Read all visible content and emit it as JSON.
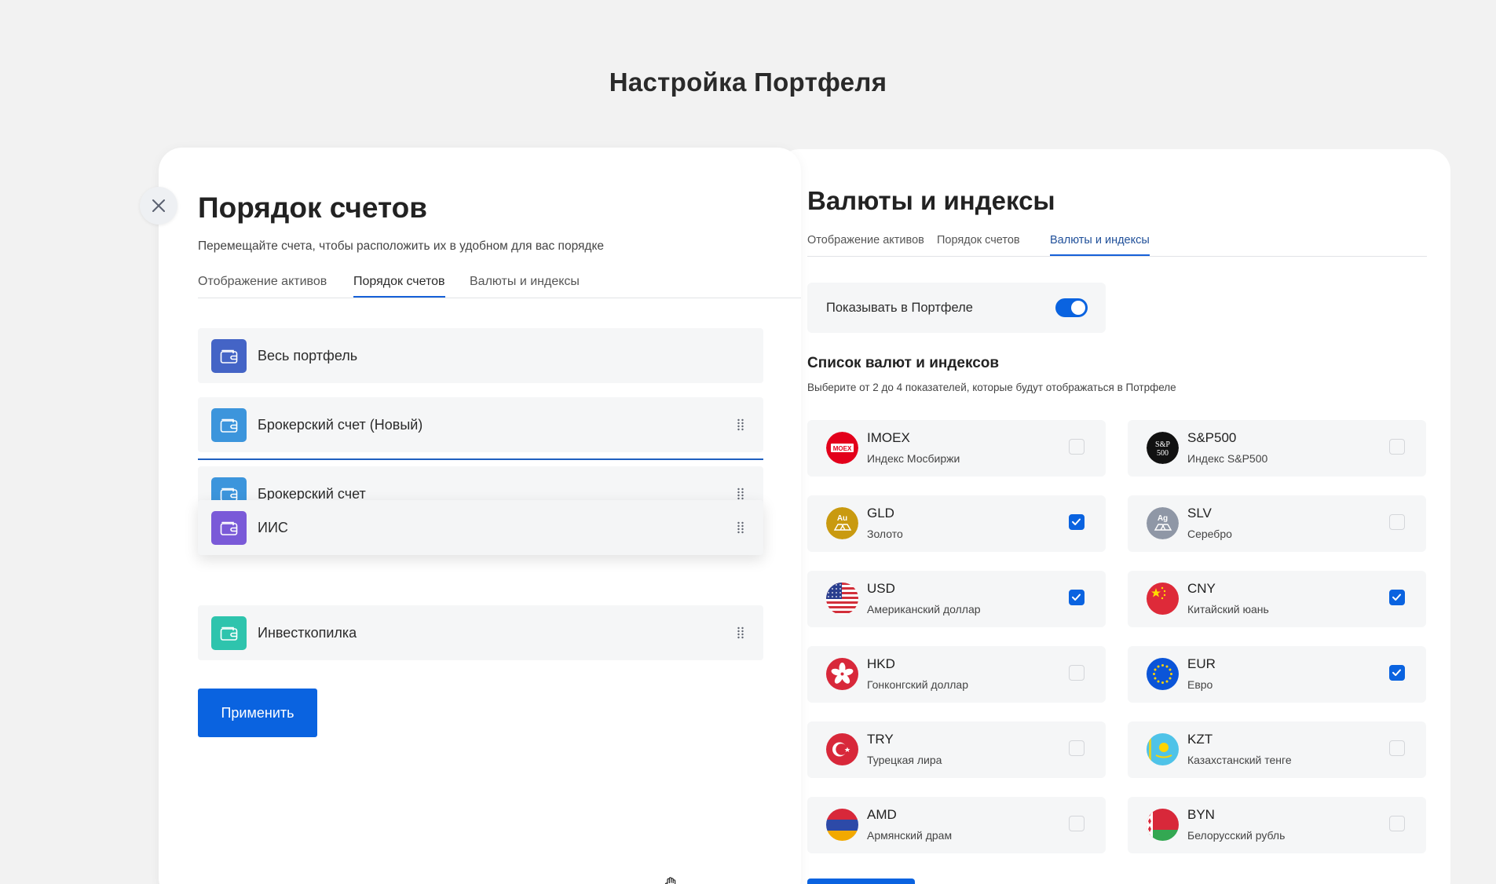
{
  "page": {
    "title": "Настройка Портфеля"
  },
  "right": {
    "title": "Валюты и индексы",
    "tabs": [
      {
        "label": "Отображение активов",
        "active": false
      },
      {
        "label": "Порядок счетов",
        "active": false
      },
      {
        "label": "Валюты и индексы",
        "active": true
      }
    ],
    "show_toggle": {
      "label": "Показывать в Портфеле",
      "on": true
    },
    "list_title": "Список валют и индексов",
    "list_subtitle": "Выберите от 2 до 4 показателей, которые будут отображаться в Потрфеле",
    "currencies": [
      {
        "code": "IMOEX",
        "name": "Индекс Мосбиржи",
        "icon": "moex-logo-icon",
        "checked": false
      },
      {
        "code": "S&P500",
        "name": "Индекс S&P500",
        "icon": "sp500-logo-icon",
        "checked": false
      },
      {
        "code": "GLD",
        "name": "Золото",
        "icon": "gold-icon",
        "checked": true
      },
      {
        "code": "SLV",
        "name": "Серебро",
        "icon": "silver-icon",
        "checked": false
      },
      {
        "code": "USD",
        "name": "Американский доллар",
        "icon": "usa-flag-icon",
        "checked": true
      },
      {
        "code": "CNY",
        "name": "Китайский юань",
        "icon": "china-flag-icon",
        "checked": true
      },
      {
        "code": "HKD",
        "name": "Гонконгский доллар",
        "icon": "hong-kong-flag-icon",
        "checked": false
      },
      {
        "code": "EUR",
        "name": "Евро",
        "icon": "eu-flag-icon",
        "checked": true
      },
      {
        "code": "TRY",
        "name": "Турецкая лира",
        "icon": "turkey-flag-icon",
        "checked": false
      },
      {
        "code": "KZT",
        "name": "Казахстанский тенге",
        "icon": "kazakhstan-flag-icon",
        "checked": false
      },
      {
        "code": "AMD",
        "name": "Армянский драм",
        "icon": "armenia-flag-icon",
        "checked": false
      },
      {
        "code": "BYN",
        "name": "Белорусский рубль",
        "icon": "belarus-flag-icon",
        "checked": false
      }
    ],
    "icon_labels": {
      "moex": "MOEX",
      "sp_line1": "S&P",
      "sp_line2": "500",
      "gold": "Au",
      "silver": "Ag"
    }
  },
  "left": {
    "title": "Порядок счетов",
    "subtitle": "Перемещайте счета, чтобы расположить их в удобном для вас порядке",
    "tabs": [
      {
        "label": "Отображение активов",
        "active": false
      },
      {
        "label": "Порядок счетов",
        "active": true
      },
      {
        "label": "Валюты и индексы",
        "active": false
      }
    ],
    "accounts": [
      {
        "label": "Весь портфель",
        "color": "#4464c6",
        "draggable": false
      },
      {
        "label": "Брокерский счет (Новый)",
        "color": "#3c95dc",
        "draggable": true
      },
      {
        "label": "Брокерский счет",
        "color": "#3c95dc",
        "draggable": true
      },
      {
        "label": "ИИС",
        "color": "#7a5ad8",
        "draggable": true,
        "dragging": true
      },
      {
        "label": "Инвесткопилка",
        "color": "#2ec4ad",
        "draggable": true
      }
    ],
    "apply_label": "Применить"
  },
  "colors": {
    "accent": "#0a63e0",
    "background": "#f2f2f2",
    "card": "#f5f6f7"
  }
}
